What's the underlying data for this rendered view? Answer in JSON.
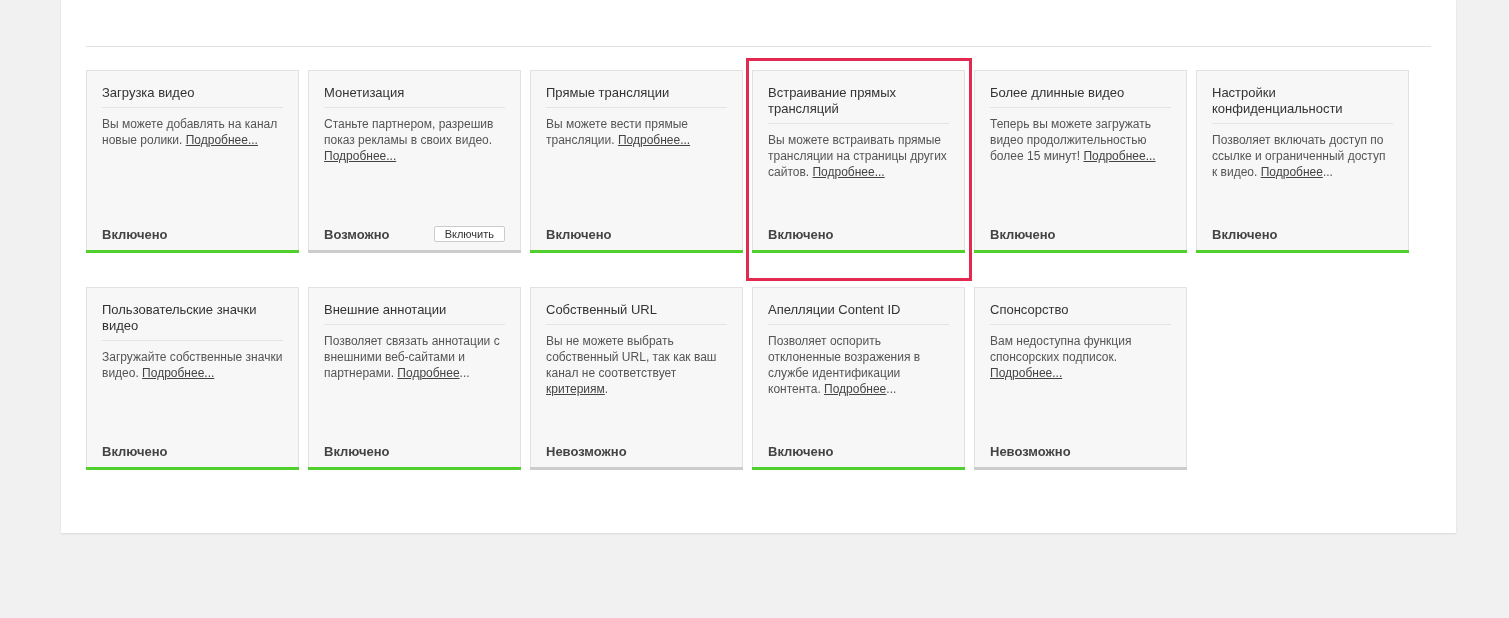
{
  "features": [
    {
      "title": "Загрузка видео",
      "text": "Вы можете добавлять на канал новые ролики. ",
      "link": "Подробнее...",
      "status": "Включено",
      "enabled": true,
      "highlighted": false
    },
    {
      "title": "Монетизация",
      "text": "Станьте партнером, разрешив показ рекламы в своих видео. ",
      "link": "Подробнее...",
      "status": "Возможно",
      "enabled": false,
      "button": "Включить",
      "highlighted": false
    },
    {
      "title": "Прямые трансляции",
      "text": "Вы можете вести прямые трансляции. ",
      "link": "Подробнее...",
      "status": "Включено",
      "enabled": true,
      "highlighted": false
    },
    {
      "title": "Встраивание прямых трансляций",
      "text": "Вы можете встраивать прямые трансляции на страницы других сайтов. ",
      "link": "Подробнее...",
      "status": "Включено",
      "enabled": true,
      "highlighted": true
    },
    {
      "title": "Более длинные видео",
      "text": "Теперь вы можете загружать видео продолжительностью более 15 минут! ",
      "link": "Подробнее...",
      "status": "Включено",
      "enabled": true,
      "highlighted": false
    },
    {
      "title": "Настройки конфиденциальности",
      "text": "Позволяет включать доступ по ссылке и ограниченный доступ к видео. ",
      "link": "Подробнее",
      "after": "...",
      "status": "Включено",
      "enabled": true,
      "highlighted": false
    },
    {
      "title": "Пользовательские значки видео",
      "text": "Загружайте собственные значки видео. ",
      "link": "Подробнее...",
      "status": "Включено",
      "enabled": true,
      "highlighted": false
    },
    {
      "title": "Внешние аннотации",
      "text": "Позволяет связать аннотации с внешними веб-сайтами и партнерами. ",
      "link": "Подробнее",
      "after": "...",
      "status": "Включено",
      "enabled": true,
      "highlighted": false
    },
    {
      "title": "Собственный URL",
      "text": "Вы не можете выбрать собственный URL, так как ваш канал не соответствует ",
      "link": "критериям",
      "after": ".",
      "status": "Невозможно",
      "enabled": false,
      "highlighted": false
    },
    {
      "title": "Апелляции Content ID",
      "text": "Позволяет оспорить отклоненные возражения в службе идентификации контента. ",
      "link": "Подробнее",
      "after": "...",
      "status": "Включено",
      "enabled": true,
      "highlighted": false
    },
    {
      "title": "Спонсорство",
      "text": "Вам недоступна функция спонсорских подписок. ",
      "link": "Подробнее...",
      "status": "Невозможно",
      "enabled": false,
      "highlighted": false
    }
  ]
}
